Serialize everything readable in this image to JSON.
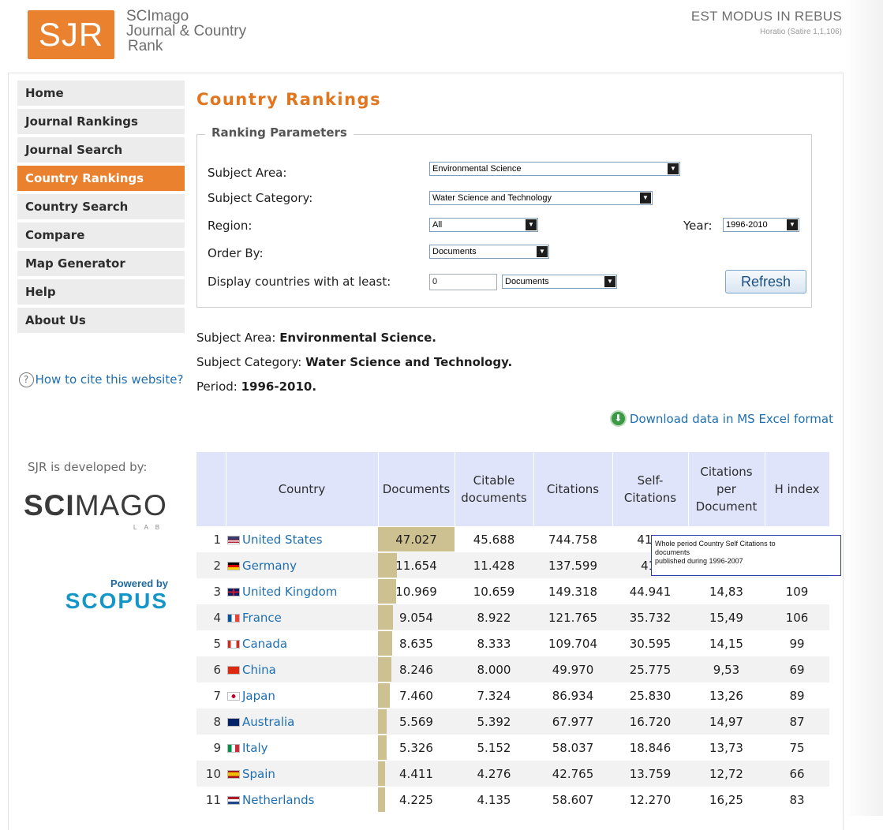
{
  "header": {
    "logo_abbr": "SJR",
    "logo_lines": [
      "SCImago",
      "Journal & Country",
      "Rank"
    ],
    "motto": "EST MODUS IN REBUS",
    "motto_source": "Horatio (Satire 1,1,106)"
  },
  "nav": {
    "items": [
      {
        "label": "Home",
        "active": false
      },
      {
        "label": "Journal Rankings",
        "active": false
      },
      {
        "label": "Journal Search",
        "active": false
      },
      {
        "label": "Country Rankings",
        "active": true
      },
      {
        "label": "Country Search",
        "active": false
      },
      {
        "label": "Compare",
        "active": false
      },
      {
        "label": "Map Generator",
        "active": false
      },
      {
        "label": "Help",
        "active": false
      },
      {
        "label": "About Us",
        "active": false
      }
    ]
  },
  "sidebar": {
    "cite_link": "How to cite this website?",
    "developed_by": "SJR is developed by:",
    "scimago_bold": "SCI",
    "scimago_rest": "MAGO",
    "scimago_lab": "LAB",
    "powered_by": "Powered by",
    "scopus": "SCOPUS"
  },
  "page": {
    "title": "Country Rankings"
  },
  "params": {
    "legend": "Ranking Parameters",
    "subject_area_label": "Subject Area:",
    "subject_area_value": "Environmental Science",
    "subject_category_label": "Subject Category:",
    "subject_category_value": "Water Science and Technology",
    "region_label": "Region:",
    "region_value": "All",
    "year_label": "Year:",
    "year_value": "1996-2010",
    "order_by_label": "Order By:",
    "order_by_value": "Documents",
    "display_label": "Display countries with at least:",
    "display_min_value": "0",
    "display_unit_value": "Documents",
    "refresh_label": "Refresh"
  },
  "summary": {
    "area_label": "Subject Area: ",
    "area_value": "Environmental Science.",
    "category_label": "Subject Category: ",
    "category_value": "Water Science and Technology.",
    "period_label": "Period: ",
    "period_value": "1996-2010."
  },
  "download_label": "Download data in MS Excel format",
  "table": {
    "columns": [
      "",
      "Country",
      "Documents",
      "Citable documents",
      "Citations",
      "Self-Citations",
      "Citations per Document",
      "H index"
    ],
    "max_documents": 47027,
    "rows": [
      {
        "rank": "1",
        "country": "United States",
        "documents": "47.027",
        "documents_num": 47027,
        "citable": "45.688",
        "citations": "744.758",
        "self": "418.",
        "cpd": "",
        "h": ""
      },
      {
        "rank": "2",
        "country": "Germany",
        "documents": "11.654",
        "documents_num": 11654,
        "citable": "11.428",
        "citations": "137.599",
        "self": "41.",
        "cpd": "",
        "h": ""
      },
      {
        "rank": "3",
        "country": "United Kingdom",
        "documents": "10.969",
        "documents_num": 10969,
        "citable": "10.659",
        "citations": "149.318",
        "self": "44.941",
        "cpd": "14,83",
        "h": "109"
      },
      {
        "rank": "4",
        "country": "France",
        "documents": "9.054",
        "documents_num": 9054,
        "citable": "8.922",
        "citations": "121.765",
        "self": "35.732",
        "cpd": "15,49",
        "h": "106"
      },
      {
        "rank": "5",
        "country": "Canada",
        "documents": "8.635",
        "documents_num": 8635,
        "citable": "8.333",
        "citations": "109.704",
        "self": "30.595",
        "cpd": "14,15",
        "h": "99"
      },
      {
        "rank": "6",
        "country": "China",
        "documents": "8.246",
        "documents_num": 8246,
        "citable": "8.000",
        "citations": "49.970",
        "self": "25.775",
        "cpd": "9,53",
        "h": "69"
      },
      {
        "rank": "7",
        "country": "Japan",
        "documents": "7.460",
        "documents_num": 7460,
        "citable": "7.324",
        "citations": "86.934",
        "self": "25.830",
        "cpd": "13,26",
        "h": "89"
      },
      {
        "rank": "8",
        "country": "Australia",
        "documents": "5.569",
        "documents_num": 5569,
        "citable": "5.392",
        "citations": "67.977",
        "self": "16.720",
        "cpd": "14,97",
        "h": "87"
      },
      {
        "rank": "9",
        "country": "Italy",
        "documents": "5.326",
        "documents_num": 5326,
        "citable": "5.152",
        "citations": "58.037",
        "self": "18.846",
        "cpd": "13,73",
        "h": "75"
      },
      {
        "rank": "10",
        "country": "Spain",
        "documents": "4.411",
        "documents_num": 4411,
        "citable": "4.276",
        "citations": "42.765",
        "self": "13.759",
        "cpd": "12,72",
        "h": "66"
      },
      {
        "rank": "11",
        "country": "Netherlands",
        "documents": "4.225",
        "documents_num": 4225,
        "citable": "4.135",
        "citations": "58.607",
        "self": "12.270",
        "cpd": "16,25",
        "h": "83"
      }
    ]
  },
  "tooltip": {
    "line1": "Whole period Country Self Citations to",
    "line2": "documents",
    "line3": "published during 1996-2007"
  },
  "colors": {
    "accent": "#e9812f",
    "title": "#e1761e",
    "link": "#1f6fb0",
    "table_header": "#dfe4fb",
    "documents_bar": "#cdc091"
  }
}
